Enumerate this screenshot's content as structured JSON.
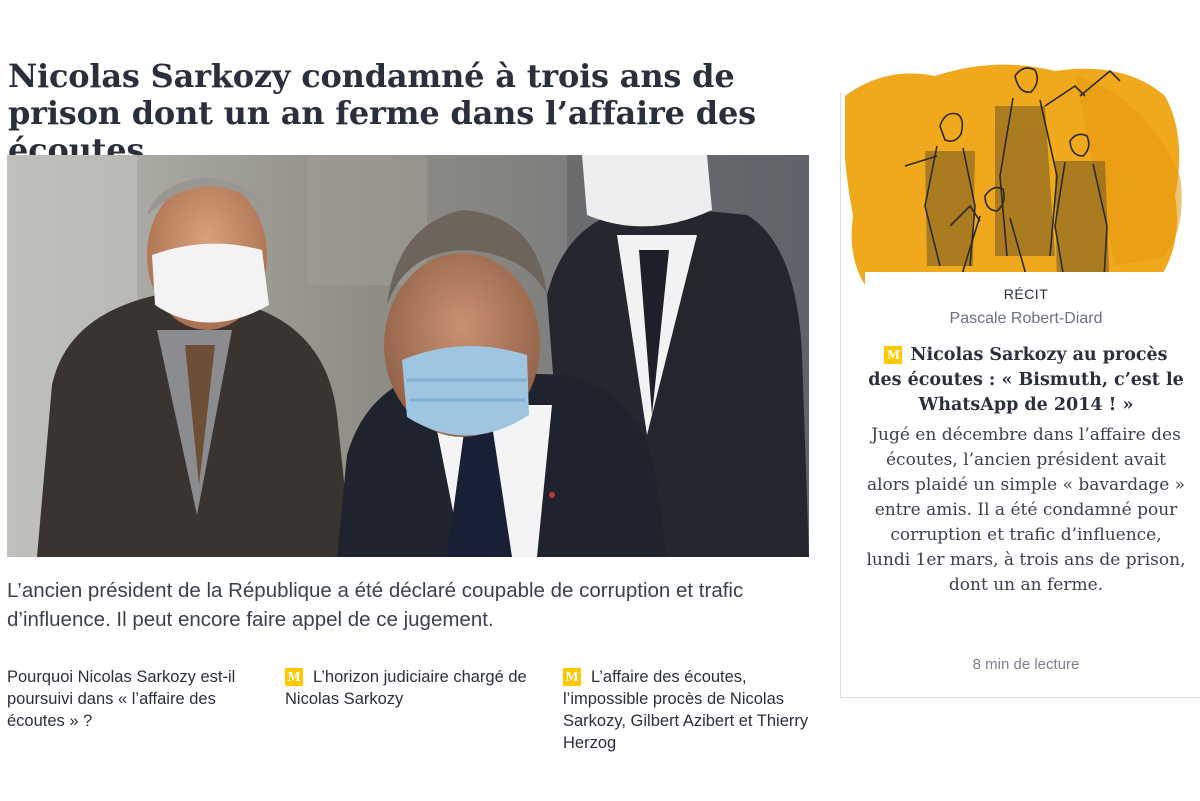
{
  "article": {
    "headline": "Nicolas Sarkozy condamné à trois ans de prison dont un an ferme dans l’affaire des écoutes",
    "standfirst": "L’ancien président de la République a été déclaré coupable de corruption et trafic d’influence. Il peut encore faire appel de ce jugement."
  },
  "related": [
    {
      "label": "Pourquoi Nicolas Sarkozy est-il poursuivi dans « l’affaire des écoutes » ?",
      "subscriber": false
    },
    {
      "label": "L’horizon judiciaire chargé de Nicolas Sarkozy",
      "subscriber": true
    },
    {
      "label": "L’affaire des écoutes, l’impossible procès de Nicolas Sarkozy, Gilbert Azibert et Thierry Herzog",
      "subscriber": true
    }
  ],
  "badge": {
    "glyph": "M",
    "color": "#ffc700",
    "icon": "le-monde-subscriber-icon"
  },
  "side_card": {
    "kicker": "RÉCIT",
    "author": "Pascale Robert-Diard",
    "title": "Nicolas Sarkozy au procès des écoutes : « Bismuth, c’est le WhatsApp de 2014 ! »",
    "description": "Jugé en décembre dans l’affaire des écoutes, l’ancien président avait alors plaidé un simple « bavardage » entre amis. Il a été condamné pour corruption et trafic d’influence, lundi 1er mars, à trois ans de prison, dont un an ferme.",
    "read_time": "8 min de lecture"
  },
  "colors": {
    "text": "#2a303b",
    "illustration_accent": "#f0a91c",
    "badge": "#ffc700"
  }
}
